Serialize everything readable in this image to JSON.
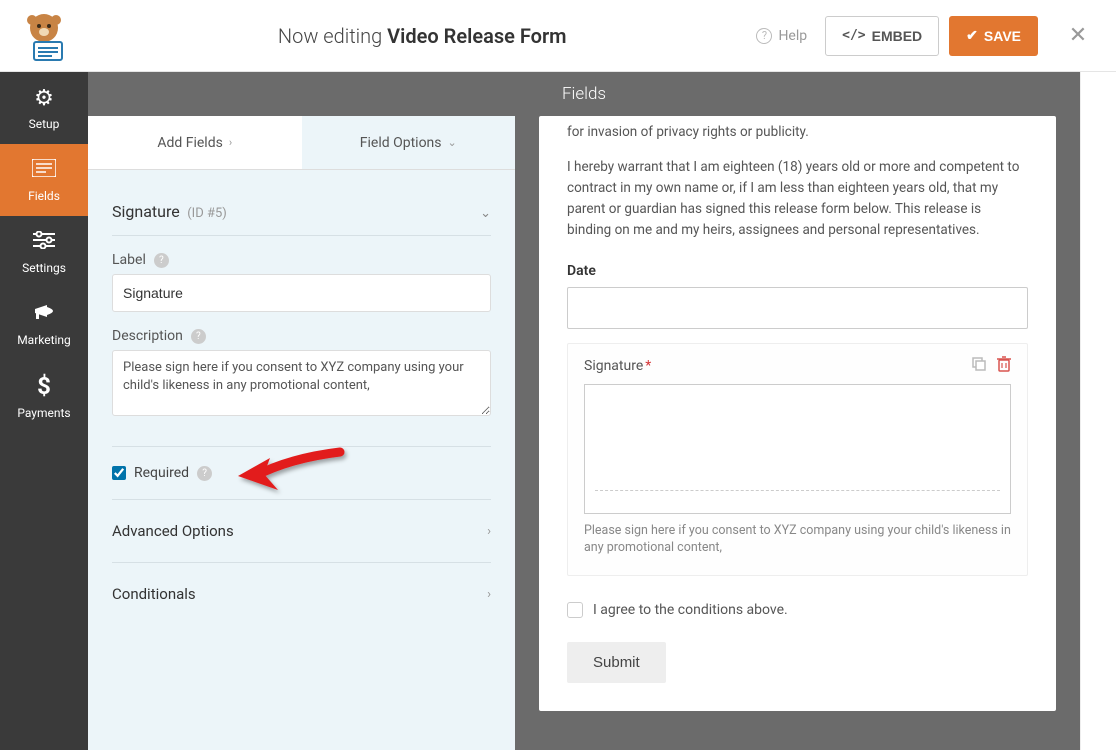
{
  "header": {
    "editing_prefix": "Now editing",
    "form_name": "Video Release Form",
    "help": "Help",
    "embed": "EMBED",
    "save": "SAVE"
  },
  "sidebar": {
    "items": [
      {
        "label": "Setup",
        "icon": "⚙"
      },
      {
        "label": "Fields",
        "icon": "≡"
      },
      {
        "label": "Settings",
        "icon": "⚙"
      },
      {
        "label": "Marketing",
        "icon": "📣"
      },
      {
        "label": "Payments",
        "icon": "$"
      }
    ]
  },
  "panel": {
    "title": "Fields",
    "tabs": {
      "add": "Add Fields",
      "options": "Field Options"
    },
    "field": {
      "name": "Signature",
      "id": "(ID #5)",
      "label_label": "Label",
      "label_value": "Signature",
      "desc_label": "Description",
      "desc_value": "Please sign here if you consent to XYZ company using your child's likeness in any promotional content,",
      "required_label": "Required",
      "required_checked": true,
      "advanced": "Advanced Options",
      "conditionals": "Conditionals"
    }
  },
  "preview": {
    "para1_frag": "for invasion of privacy rights or publicity.",
    "para2": "I hereby warrant that I am eighteen (18) years old or more and competent to contract in my own name or, if I am less than eighteen years old, that my parent or guardian has signed this release form below. This release is binding on me and my heirs, assignees and personal representatives.",
    "date_label": "Date",
    "signature_label": "Signature",
    "signature_desc": "Please sign here if you consent to XYZ company using your child's likeness in any promotional content,",
    "agree_label": "I agree to the conditions above.",
    "submit": "Submit"
  }
}
